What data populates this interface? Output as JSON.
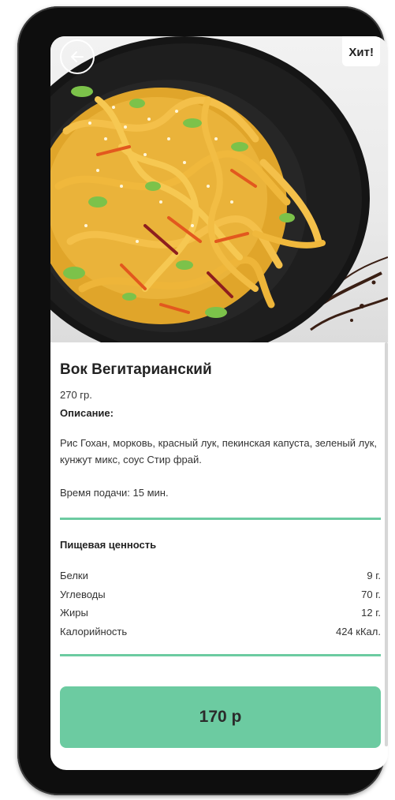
{
  "product": {
    "badge": "Хит!",
    "title": "Вок Вегитарианский",
    "weight": "270 гр.",
    "description_label": "Описание:",
    "description": "Рис Гохан, морковь, красный лук, пекинская капуста, зеленый лук, кунжут микс, соус Стир фрай.",
    "serve_time": "Время подачи: 15 мин.",
    "price": "170 р"
  },
  "nutrition": {
    "title": "Пищевая ценность",
    "rows": [
      {
        "name": "Белки",
        "value": "9 г."
      },
      {
        "name": "Углеводы",
        "value": "70 г."
      },
      {
        "name": "Жиры",
        "value": "12 г."
      },
      {
        "name": "Калорийность",
        "value": "424 кКал."
      }
    ]
  },
  "icons": {
    "back": "arrow-left-icon"
  },
  "colors": {
    "accent": "#6ccba1",
    "phone_frame": "#0e0e0e",
    "text": "#222222"
  }
}
